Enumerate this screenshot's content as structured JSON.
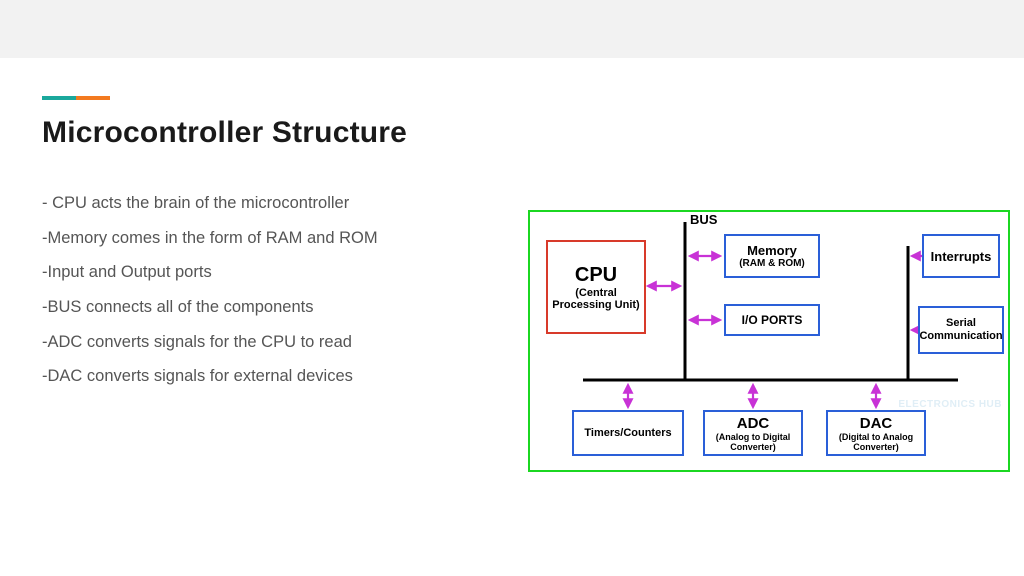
{
  "slide": {
    "title": "Microcontroller Structure",
    "bullets": [
      "- CPU acts the brain of the microcontroller",
      "-Memory comes in the form of RAM and ROM",
      "-Input and Output ports",
      "-BUS connects all of the components",
      "-ADC converts signals for the CPU to read",
      "-DAC converts signals for external devices"
    ]
  },
  "diagram": {
    "bus_label": "BUS",
    "watermark": "ELECTRONICS HUB",
    "blocks": {
      "cpu": {
        "title": "CPU",
        "sub": "(Central Processing Unit)"
      },
      "memory": {
        "title": "Memory",
        "sub": "(RAM & ROM)"
      },
      "interrupts": {
        "title": "Interrupts",
        "sub": ""
      },
      "ioports": {
        "title": "I/O PORTS",
        "sub": ""
      },
      "serial": {
        "title": "Serial Communication",
        "sub": ""
      },
      "timers": {
        "title": "Timers/Counters",
        "sub": ""
      },
      "adc": {
        "title": "ADC",
        "sub": "(Analog to Digital Converter)"
      },
      "dac": {
        "title": "DAC",
        "sub": "(Digital to Analog Converter)"
      }
    }
  }
}
